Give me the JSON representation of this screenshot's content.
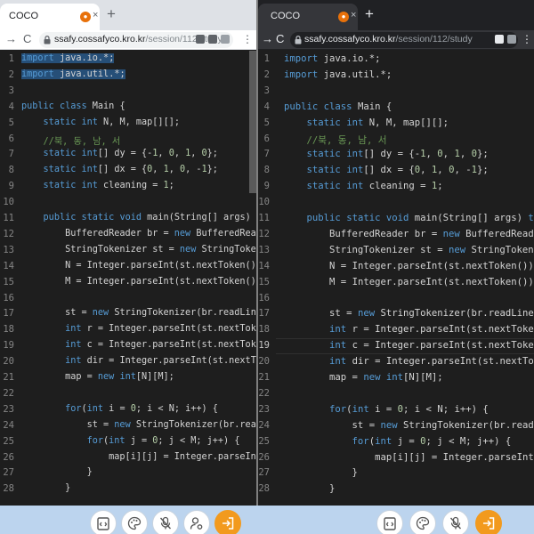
{
  "browser": {
    "tab_title": "COCO",
    "new_tab_symbol": "+",
    "tab_close_symbol": "×",
    "url_host": "ssafy.cossafyco.kro.kr",
    "url_path": "/session/112/study",
    "back_symbol": "→",
    "forward_symbol": "→",
    "reload_symbol": "C",
    "more_symbol": "⋮"
  },
  "left_editor": {
    "active_line": null,
    "lines": [
      {
        "n": "1",
        "text": "import java.io.*;"
      },
      {
        "n": "2",
        "text": "import java.util.*;"
      },
      {
        "n": "3",
        "text": ""
      },
      {
        "n": "4",
        "text": "public class Main {"
      },
      {
        "n": "5",
        "text": "    static int N, M, map[][];"
      },
      {
        "n": "6",
        "text": "    //북, 동, 남, 서"
      },
      {
        "n": "7",
        "text": "    static int[] dy = {-1, 0, 1, 0};"
      },
      {
        "n": "8",
        "text": "    static int[] dx = {0, 1, 0, -1};"
      },
      {
        "n": "9",
        "text": "    static int cleaning = 1;"
      },
      {
        "n": "10",
        "text": ""
      },
      {
        "n": "11",
        "text": "    public static void main(String[] args) throws Ex"
      },
      {
        "n": "12",
        "text": "        BufferedReader br = new BufferedReader(new I"
      },
      {
        "n": "13",
        "text": "        StringTokenizer st = new StringTokenizer(br."
      },
      {
        "n": "14",
        "text": "        N = Integer.parseInt(st.nextToken());"
      },
      {
        "n": "15",
        "text": "        M = Integer.parseInt(st.nextToken());"
      },
      {
        "n": "16",
        "text": ""
      },
      {
        "n": "17",
        "text": "        st = new StringTokenizer(br.readLine());"
      },
      {
        "n": "18",
        "text": "        int r = Integer.parseInt(st.nextToken());"
      },
      {
        "n": "19",
        "text": "        int c = Integer.parseInt(st.nextToken());"
      },
      {
        "n": "20",
        "text": "        int dir = Integer.parseInt(st.nextToken());"
      },
      {
        "n": "21",
        "text": "        map = new int[N][M];"
      },
      {
        "n": "22",
        "text": ""
      },
      {
        "n": "23",
        "text": "        for(int i = 0; i < N; i++) {"
      },
      {
        "n": "24",
        "text": "            st = new StringTokenizer(br.readLine());"
      },
      {
        "n": "25",
        "text": "            for(int j = 0; j < M; j++) {"
      },
      {
        "n": "26",
        "text": "                map[i][j] = Integer.parseInt(st.next"
      },
      {
        "n": "27",
        "text": "            }"
      },
      {
        "n": "28",
        "text": "        }"
      }
    ]
  },
  "right_editor": {
    "active_line": "19",
    "lines": [
      {
        "n": "1",
        "text": "import java.io.*;"
      },
      {
        "n": "2",
        "text": "import java.util.*;"
      },
      {
        "n": "3",
        "text": ""
      },
      {
        "n": "4",
        "text": "public class Main {"
      },
      {
        "n": "5",
        "text": "    static int N, M, map[][];"
      },
      {
        "n": "6",
        "text": "    //북, 동, 남, 서"
      },
      {
        "n": "7",
        "text": "    static int[] dy = {-1, 0, 1, 0};"
      },
      {
        "n": "8",
        "text": "    static int[] dx = {0, 1, 0, -1};"
      },
      {
        "n": "9",
        "text": "    static int cleaning = 1;"
      },
      {
        "n": "10",
        "text": ""
      },
      {
        "n": "11",
        "text": "    public static void main(String[] args) throws E"
      },
      {
        "n": "12",
        "text": "        BufferedReader br = new BufferedReader(new"
      },
      {
        "n": "13",
        "text": "        StringTokenizer st = new StringTokenizer(br"
      },
      {
        "n": "14",
        "text": "        N = Integer.parseInt(st.nextToken());"
      },
      {
        "n": "15",
        "text": "        M = Integer.parseInt(st.nextToken());"
      },
      {
        "n": "16",
        "text": ""
      },
      {
        "n": "17",
        "text": "        st = new StringTokenizer(br.readLine());"
      },
      {
        "n": "18",
        "text": "        int r = Integer.parseInt(st.nextToken());"
      },
      {
        "n": "19",
        "text": "        int c = Integer.parseInt(st.nextToken());"
      },
      {
        "n": "20",
        "text": "        int dir = Integer.parseInt(st.nextToken());"
      },
      {
        "n": "21",
        "text": "        map = new int[N][M];"
      },
      {
        "n": "22",
        "text": ""
      },
      {
        "n": "23",
        "text": "        for(int i = 0; i < N; i++) {"
      },
      {
        "n": "24",
        "text": "            st = new StringTokenizer(br.readLine()"
      },
      {
        "n": "25",
        "text": "            for(int j = 0; j < M; j++) {"
      },
      {
        "n": "26",
        "text": "                map[i][j] = Integer.parseInt(st.nex"
      },
      {
        "n": "27",
        "text": "            }"
      },
      {
        "n": "28",
        "text": "        }"
      }
    ]
  },
  "meeting_controls": [
    {
      "name": "code-share-icon"
    },
    {
      "name": "palette-icon"
    },
    {
      "name": "mic-muted-icon"
    },
    {
      "name": "user-settings-icon"
    },
    {
      "name": "leave-icon"
    }
  ],
  "colors": {
    "editor_bg": "#1e1e1e",
    "keyword": "#569cd6",
    "comment": "#6a9955",
    "number": "#b5cea8",
    "selection": "#264f78",
    "leave_button": "#f29a1e",
    "bottom_bar": "#bcd4ee"
  }
}
